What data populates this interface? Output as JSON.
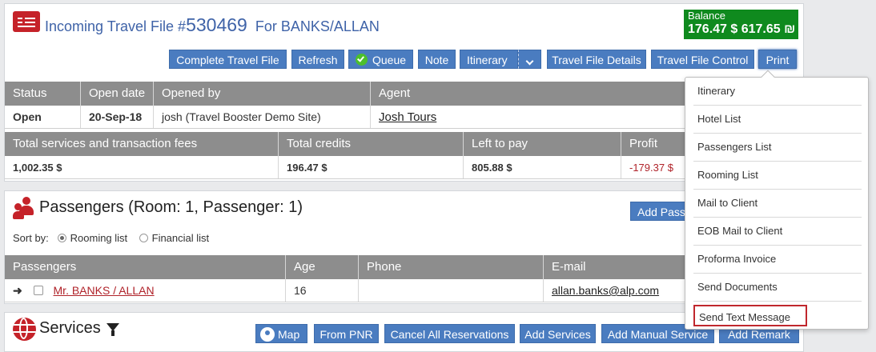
{
  "header": {
    "title_prefix": "Incoming Travel File #",
    "file_number": "530469",
    "for_label": "For BANKS/ALLAN",
    "balance_label": "Balance",
    "balance_value": "176.47 $ 617.65 ₪"
  },
  "toolbar": {
    "complete": "Complete Travel File",
    "refresh": "Refresh",
    "queue": "Queue",
    "note": "Note",
    "itinerary": "Itinerary",
    "details": "Travel File Details",
    "control": "Travel File Control",
    "print": "Print"
  },
  "file_table": {
    "headers": [
      "Status",
      "Open date",
      "Opened by",
      "Agent"
    ],
    "values": [
      "Open",
      "20-Sep-18",
      "josh (Travel Booster Demo Site)",
      "Josh Tours"
    ]
  },
  "totals_table": {
    "headers": [
      "Total services and transaction fees",
      "Total credits",
      "Left to pay",
      "Profit"
    ],
    "values": [
      "1,002.35 $",
      "196.47 $",
      "805.88 $",
      "-179.37 $"
    ]
  },
  "passengers": {
    "title": "Passengers (Room: 1, Passenger: 1)",
    "add_button": "Add Pass",
    "sort_label": "Sort by:",
    "sort_options": [
      "Rooming list",
      "Financial list"
    ],
    "headers": [
      "Passengers",
      "Age",
      "Phone",
      "E-mail"
    ],
    "rows": [
      {
        "name": "Mr. BANKS / ALLAN",
        "age": "16",
        "phone": "",
        "email": "allan.banks@alp.com"
      }
    ]
  },
  "services": {
    "title": "Services",
    "buttons": [
      "Map",
      "From PNR",
      "Cancel All Reservations",
      "Add Services",
      "Add Manual Service",
      "Add Remark"
    ]
  },
  "print_menu": {
    "items": [
      "Itinerary",
      "Hotel List",
      "Passengers List",
      "Rooming List",
      "Mail to Client",
      "EOB Mail to Client",
      "Proforma Invoice",
      "Send Documents",
      "Send Text Message"
    ]
  },
  "colors": {
    "button": "#4a7cc0",
    "title": "#3f63a8",
    "balance": "#0f8a1e",
    "profit_negative": "#b0232a",
    "icon_red": "#c52229"
  }
}
